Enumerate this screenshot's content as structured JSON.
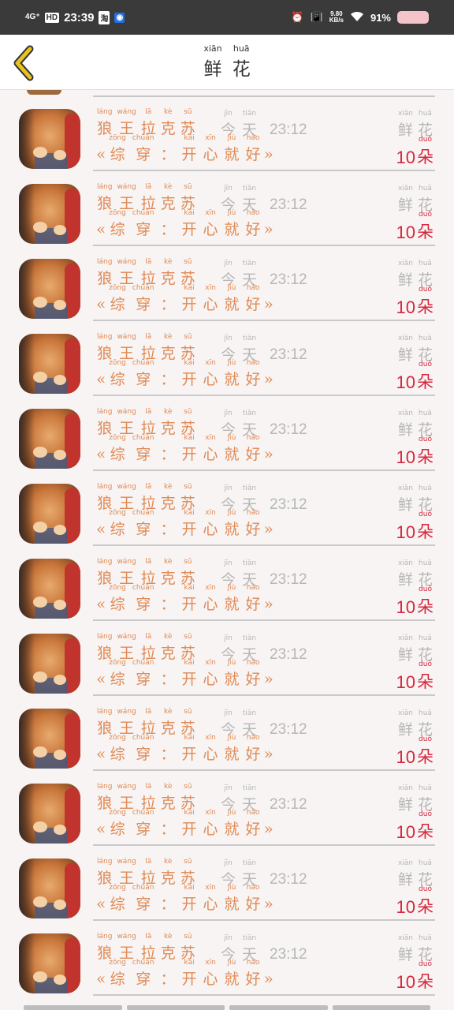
{
  "status_bar": {
    "network": "4G⁺",
    "hd": "HD",
    "time": "23:39",
    "app_badge_1": "淘",
    "speed_value": "9.80",
    "speed_unit": "KB/s",
    "battery_percent": "91%"
  },
  "header": {
    "title_chars": [
      {
        "py": "xiān",
        "hz": "鲜"
      },
      {
        "py": "huā",
        "hz": "花"
      }
    ]
  },
  "list": {
    "items": [
      {
        "nickname": [
          {
            "py": "láng",
            "hz": "狼"
          },
          {
            "py": "wáng",
            "hz": "王"
          },
          {
            "py": "lā",
            "hz": "拉"
          },
          {
            "py": "kè",
            "hz": "克"
          },
          {
            "py": "sū",
            "hz": "苏"
          }
        ],
        "time_word": [
          {
            "py": "jīn",
            "hz": "今"
          },
          {
            "py": "tiān",
            "hz": "天"
          }
        ],
        "time": "23:12",
        "quote_open": "«",
        "message": [
          {
            "py": "zōng",
            "hz": "综"
          },
          {
            "py": "chuān",
            "hz": "穿"
          },
          {
            "py": "",
            "hz": "："
          },
          {
            "py": "kāi",
            "hz": "开"
          },
          {
            "py": "xīn",
            "hz": "心"
          },
          {
            "py": "jiù",
            "hz": "就"
          },
          {
            "py": "hǎo",
            "hz": "好"
          }
        ],
        "quote_close": "»",
        "gift_name": [
          {
            "py": "xiān",
            "hz": "鲜"
          },
          {
            "py": "huā",
            "hz": "花"
          }
        ],
        "gift_count": "10",
        "gift_unit": {
          "py": "duǒ",
          "hz": "朵"
        }
      }
    ],
    "repeat": 12
  },
  "colors": {
    "accent_orange": "#e08a56",
    "accent_red": "#d7263d",
    "muted_gray": "#b7b7b7",
    "back_arrow_yellow": "#e8c21e"
  }
}
